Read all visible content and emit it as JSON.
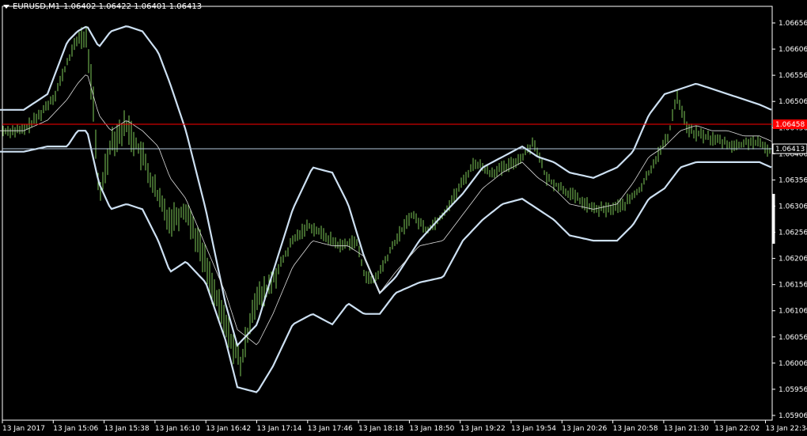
{
  "header": {
    "symbol": "EURUSD,M1",
    "ohlc": "1.06402 1.06422 1.06401 1.06413"
  },
  "price_axis": {
    "min": 1.05906,
    "max": 1.06656,
    "ticks": [
      "1.06656",
      "1.06606",
      "1.06556",
      "1.06506",
      "1.06456",
      "1.06406",
      "1.06356",
      "1.06306",
      "1.06256",
      "1.06206",
      "1.06156",
      "1.06106",
      "1.06056",
      "1.06006",
      "1.05956",
      "1.05906"
    ]
  },
  "time_axis": {
    "labels": [
      "13 Jan 2017",
      "13 Jan 15:06",
      "13 Jan 15:38",
      "13 Jan 16:10",
      "13 Jan 16:42",
      "13 Jan 17:14",
      "13 Jan 17:46",
      "13 Jan 18:18",
      "13 Jan 18:50",
      "13 Jan 19:22",
      "13 Jan 19:54",
      "13 Jan 20:26",
      "13 Jan 20:58",
      "13 Jan 21:30",
      "13 Jan 22:02",
      "13 Jan 22:34"
    ]
  },
  "levels": {
    "red_line": {
      "price_label": "1.06458",
      "color": "#ff0000"
    },
    "bid_line": {
      "price_label": "1.06413",
      "color": "#b4c8dc"
    }
  },
  "colors": {
    "background": "#000000",
    "bars": "#7fcc5a",
    "bands": "#cde0f2",
    "middle_band": "#dddddd",
    "axis": "#ffffff"
  },
  "chart_data": {
    "type": "line",
    "series": [
      {
        "name": "upper band",
        "x": [
          0,
          30,
          60,
          85,
          98,
          110,
          125,
          140,
          160,
          180,
          200,
          215,
          235,
          260,
          285,
          300,
          325,
          345,
          370,
          395,
          420,
          440,
          460,
          480,
          500,
          530,
          560,
          585,
          610,
          635,
          660,
          680,
          700,
          720,
          750,
          780,
          800,
          820,
          840,
          860,
          880,
          900,
          920,
          940,
          960,
          975
        ],
        "y": [
          1.0649,
          1.0649,
          1.0652,
          1.0662,
          1.0664,
          1.0665,
          1.0661,
          1.0664,
          1.0665,
          1.0664,
          1.066,
          1.0654,
          1.0645,
          1.063,
          1.0612,
          1.0604,
          1.0608,
          1.0618,
          1.063,
          1.0638,
          1.0637,
          1.0631,
          1.0621,
          1.0614,
          1.0617,
          1.0624,
          1.0629,
          1.0633,
          1.0638,
          1.064,
          1.0642,
          1.064,
          1.0639,
          1.0637,
          1.0636,
          1.0638,
          1.0641,
          1.0648,
          1.0652,
          1.0653,
          1.0654,
          1.0653,
          1.0652,
          1.0651,
          1.065,
          1.0649
        ]
      },
      {
        "name": "middle band",
        "x": [
          0,
          30,
          60,
          85,
          98,
          110,
          125,
          140,
          160,
          180,
          200,
          215,
          235,
          260,
          285,
          300,
          325,
          345,
          370,
          395,
          420,
          440,
          460,
          480,
          500,
          530,
          560,
          585,
          610,
          635,
          660,
          680,
          700,
          720,
          750,
          780,
          800,
          820,
          840,
          860,
          880,
          900,
          920,
          940,
          960,
          975
        ],
        "y": [
          1.0645,
          1.0645,
          1.0647,
          1.0651,
          1.0654,
          1.0656,
          1.0648,
          1.0645,
          1.0647,
          1.0645,
          1.0642,
          1.0636,
          1.0632,
          1.0623,
          1.0614,
          1.0607,
          1.0604,
          1.061,
          1.0619,
          1.0624,
          1.0623,
          1.0623,
          1.0621,
          1.0614,
          1.0618,
          1.0623,
          1.0624,
          1.0629,
          1.0634,
          1.0637,
          1.0639,
          1.0636,
          1.0634,
          1.0631,
          1.063,
          1.0631,
          1.0635,
          1.064,
          1.0642,
          1.0645,
          1.0646,
          1.0645,
          1.0645,
          1.0644,
          1.0644,
          1.0643
        ]
      },
      {
        "name": "lower band",
        "x": [
          0,
          30,
          60,
          85,
          98,
          110,
          125,
          140,
          160,
          180,
          200,
          215,
          235,
          260,
          285,
          300,
          325,
          345,
          370,
          395,
          420,
          440,
          460,
          480,
          500,
          530,
          560,
          585,
          610,
          635,
          660,
          680,
          700,
          720,
          750,
          780,
          800,
          820,
          840,
          860,
          880,
          900,
          920,
          940,
          960,
          975
        ],
        "y": [
          1.0641,
          1.0641,
          1.0642,
          1.0642,
          1.0645,
          1.0645,
          1.0635,
          1.063,
          1.0631,
          1.063,
          1.0624,
          1.0618,
          1.062,
          1.0616,
          1.0605,
          1.0596,
          1.0595,
          1.06,
          1.0608,
          1.061,
          1.0608,
          1.0612,
          1.061,
          1.061,
          1.0614,
          1.0616,
          1.0617,
          1.0624,
          1.0628,
          1.0631,
          1.0632,
          1.063,
          1.0628,
          1.0625,
          1.0624,
          1.0624,
          1.0627,
          1.0632,
          1.0634,
          1.0638,
          1.0639,
          1.0639,
          1.0639,
          1.0639,
          1.0639,
          1.0638
        ]
      },
      {
        "name": "price",
        "x": [
          0,
          30,
          50,
          70,
          90,
          100,
          110,
          118,
          125,
          140,
          160,
          180,
          200,
          215,
          235,
          255,
          275,
          295,
          305,
          320,
          335,
          350,
          370,
          390,
          410,
          430,
          450,
          460,
          470,
          480,
          500,
          520,
          540,
          560,
          580,
          600,
          620,
          640,
          660,
          675,
          690,
          710,
          730,
          750,
          770,
          790,
          810,
          830,
          845,
          855,
          870,
          890,
          910,
          930,
          950,
          965,
          975
        ],
        "y": [
          1.0645,
          1.0645,
          1.0648,
          1.0652,
          1.066,
          1.0663,
          1.0662,
          1.065,
          1.0632,
          1.0643,
          1.0646,
          1.064,
          1.0632,
          1.0628,
          1.063,
          1.0622,
          1.0612,
          1.0604,
          1.06,
          1.0612,
          1.0614,
          1.0618,
          1.0624,
          1.0627,
          1.0625,
          1.0623,
          1.0624,
          1.0618,
          1.0616,
          1.0618,
          1.0624,
          1.0629,
          1.0626,
          1.0629,
          1.0634,
          1.0639,
          1.0637,
          1.0638,
          1.064,
          1.0643,
          1.0636,
          1.0634,
          1.0632,
          1.063,
          1.063,
          1.0631,
          1.0634,
          1.064,
          1.0644,
          1.0652,
          1.0645,
          1.0644,
          1.0643,
          1.0642,
          1.0643,
          1.0642,
          1.0641
        ]
      }
    ]
  }
}
